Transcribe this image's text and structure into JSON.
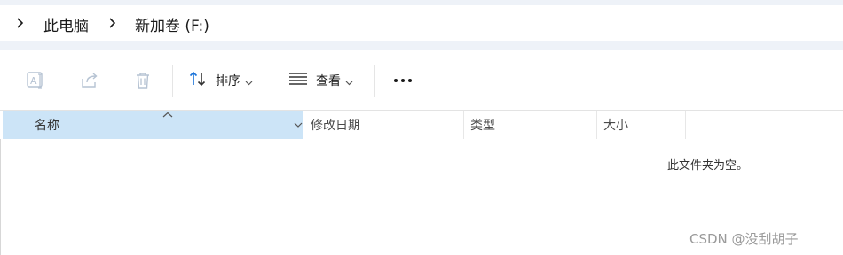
{
  "breadcrumb": {
    "items": [
      "此电脑",
      "新加卷 (F:)"
    ]
  },
  "toolbar": {
    "rename_icon": "rename-icon",
    "share_icon": "share-icon",
    "delete_icon": "trash-icon",
    "sort_label": "排序",
    "view_label": "查看",
    "more_icon": "more-icon"
  },
  "columns": {
    "name": "名称",
    "modified": "修改日期",
    "type": "类型",
    "size": "大小"
  },
  "content": {
    "empty_message": "此文件夹为空。"
  },
  "watermark": "CSDN @没刮胡子",
  "colors": {
    "accent": "#1a73d9",
    "selected_header": "#cce4f7",
    "disabled_icon": "#b6c3d3"
  }
}
